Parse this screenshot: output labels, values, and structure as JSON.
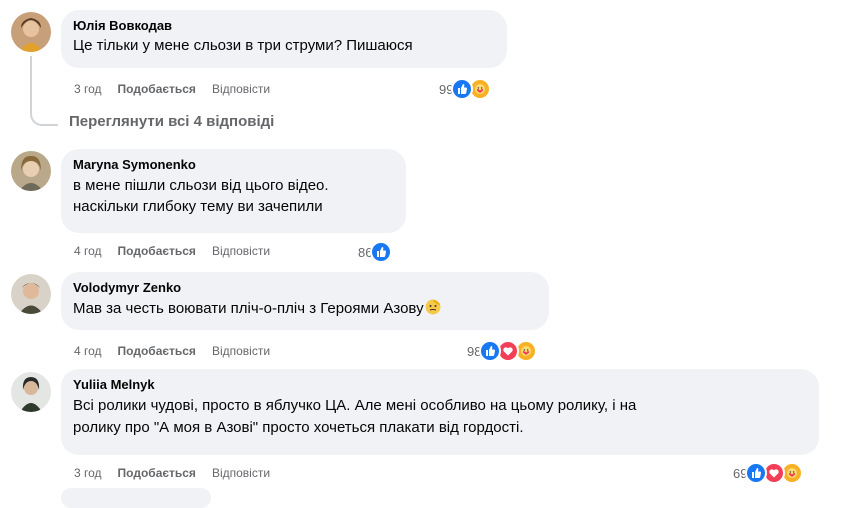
{
  "comments": [
    {
      "author": "Юлія Вовкодав",
      "text": "Це тільки у мене сльози в три струми? Пишаюся",
      "time": "3 год",
      "like": "Подобається",
      "reply": "Відповісти",
      "reaction_count": "99",
      "reactions": [
        "like-icon",
        "care-icon"
      ]
    },
    {
      "author": "Maryna Symonenko",
      "text": "в мене пішли сльози від цього відео.\nнаскільки глибоку тему ви зачепили",
      "time": "4 год",
      "like": "Подобається",
      "reply": "Відповісти",
      "reaction_count": "86",
      "reactions": [
        "like-icon"
      ]
    },
    {
      "author": "Volodymyr Zenko",
      "text": "Мав за честь воювати пліч-о-пліч з Героями Азову",
      "time": "4 год",
      "like": "Подобається",
      "reply": "Відповісти",
      "reaction_count": "98",
      "reactions": [
        "like-icon",
        "love-icon",
        "care-icon"
      ]
    },
    {
      "author": "Yuliia Melnyk",
      "text": "Всі ролики чудові, просто в яблучко ЦА. Але мені особливо на цьому ролику, і на\nролику про \"А моя в Азові\" просто хочеться плакати від гордості.",
      "time": "3 год",
      "like": "Подобається",
      "reply": "Відповісти",
      "reaction_count": "69",
      "reactions": [
        "like-icon",
        "love-icon",
        "care-icon"
      ]
    }
  ],
  "view_replies": "Переглянути всі 4 відповіді",
  "colors": {
    "bubble": "#f0f2f5",
    "meta": "#65676b",
    "like": "#1877f2",
    "love": "#f33e58",
    "care": "#f7b125"
  }
}
